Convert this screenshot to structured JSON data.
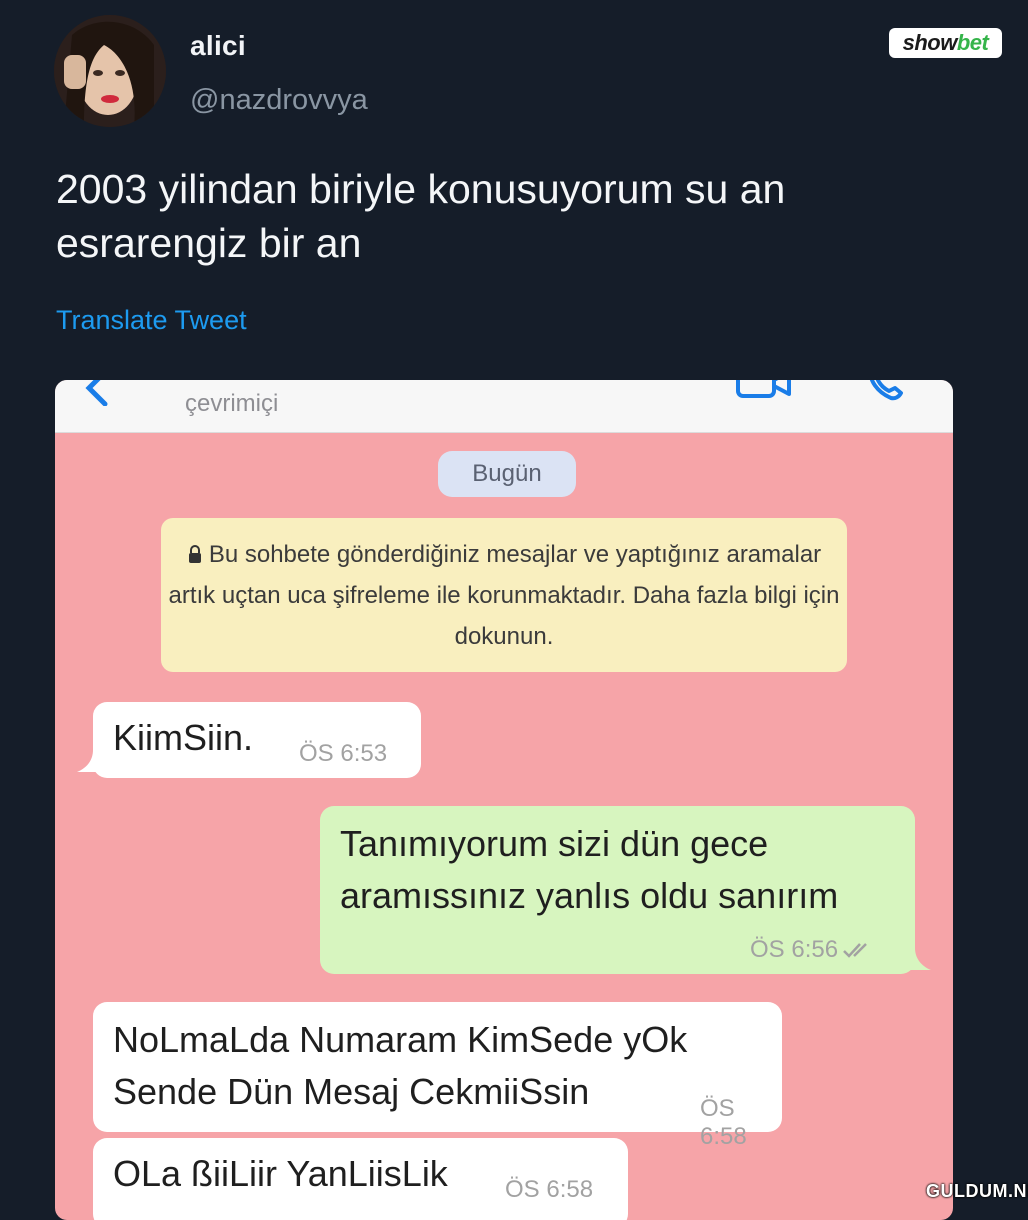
{
  "tweet": {
    "display_name": "alici",
    "handle": "@nazdrovvya",
    "text": "2003 yilindan biriyle konusuyorum su an esrarengiz bir an",
    "translate_label": "Translate Tweet"
  },
  "watermarks": {
    "brand_part1": "show",
    "brand_part2": "bet",
    "site": "GULDUM.NET"
  },
  "chat": {
    "status": "çevrimiçi",
    "date_label": "Bugün",
    "encryption_notice": "Bu sohbete gönderdiğiniz mesajlar ve yaptığınız aramalar artık uçtan uca şifreleme ile korunmaktadır. Daha fazla bilgi için dokunun.",
    "messages": [
      {
        "direction": "incoming",
        "text": "KiimSiin.",
        "time": "ÖS 6:53"
      },
      {
        "direction": "outgoing",
        "text": "Tanımıyorum sizi dün gece aramıssınız yanlıs oldu sanırım",
        "time": "ÖS 6:56",
        "status": "read"
      },
      {
        "direction": "incoming",
        "text": "NoLmaLda Numaram KimSede yOk Sende Dün Mesaj CekmiiSsin",
        "time": "ÖS 6:58"
      },
      {
        "direction": "incoming",
        "text": "OLa ßiiLiir YanLiisLik",
        "time": "ÖS 6:58"
      }
    ]
  },
  "colors": {
    "page_background": "#151d29",
    "chat_background": "#f6a4a8",
    "outgoing_bubble": "#d7f5bf",
    "incoming_bubble": "#ffffff",
    "notice_background": "#f9efbf",
    "link": "#1d9bf0"
  },
  "icons": {
    "back": "chevron-left-icon",
    "video_call": "video-call-icon",
    "voice_call": "phone-icon",
    "encryption": "lock-icon",
    "read_receipt": "double-check-icon"
  }
}
